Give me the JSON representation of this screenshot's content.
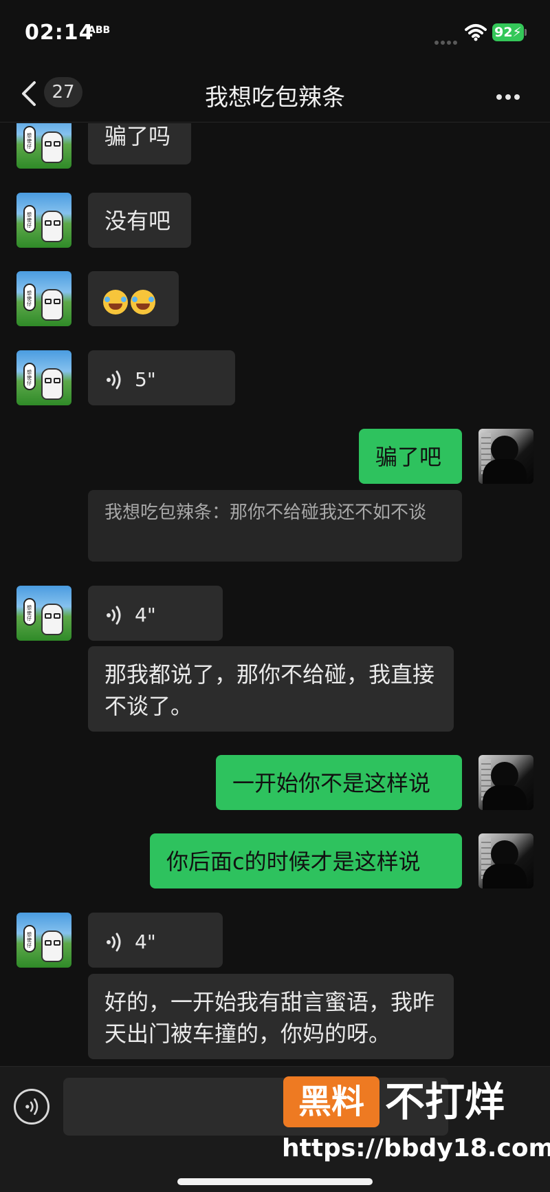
{
  "status_bar": {
    "time": "02:14",
    "app_tag": "ABB",
    "battery": "92",
    "battery_color": "#34c759"
  },
  "nav": {
    "back_badge": "27",
    "title": "我想吃包辣条",
    "more_icon": "more-icon"
  },
  "messages": [
    {
      "id": "m1",
      "side": "in",
      "type": "text",
      "text": "骗了吗"
    },
    {
      "id": "m2",
      "side": "in",
      "type": "text",
      "text": "没有吧"
    },
    {
      "id": "m3",
      "side": "in",
      "type": "emoji",
      "emoji": [
        "crying-laughing-emoji",
        "tears-of-joy-emoji"
      ]
    },
    {
      "id": "m4",
      "side": "in",
      "type": "voice",
      "duration": "5\""
    },
    {
      "id": "m5",
      "side": "out",
      "type": "text",
      "text": "骗了吧"
    },
    {
      "id": "m6",
      "side": "out",
      "type": "quote",
      "text": "我想吃包辣条：那你不给碰我还不如不谈"
    },
    {
      "id": "m7",
      "side": "in",
      "type": "voice",
      "duration": "4\""
    },
    {
      "id": "m8",
      "side": "in",
      "type": "text",
      "text": "那我都说了，那你不给碰，我直接不谈了。"
    },
    {
      "id": "m9",
      "side": "out",
      "type": "text",
      "text": "一开始你不是这样说"
    },
    {
      "id": "m10",
      "side": "out",
      "type": "text",
      "text": "你后面c的时候才是这样说"
    },
    {
      "id": "m11",
      "side": "in",
      "type": "voice",
      "duration": "4\""
    },
    {
      "id": "m12",
      "side": "in",
      "type": "text",
      "text": "好的，一开始我有甜言蜜语，我昨天出门被车撞的，你妈的呀。"
    }
  ],
  "input": {
    "value": "",
    "placeholder": ""
  },
  "watermark": {
    "box_text": "黑料",
    "text": "不打烊",
    "url": "https://bbdy18.com"
  },
  "colors": {
    "background": "#111111",
    "incoming_bubble": "#2c2c2c",
    "outgoing_bubble": "#2ec25e",
    "watermark_box": "#ee7a22"
  }
}
